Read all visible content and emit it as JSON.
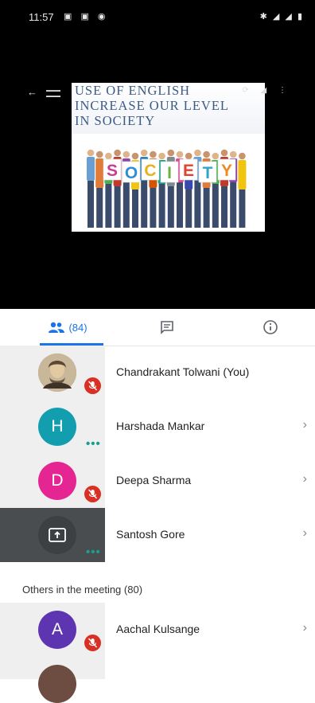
{
  "status_bar": {
    "time": "11:57"
  },
  "presentation": {
    "title_line1": "USE OF ENGLISH",
    "title_line2": "INCREASE OUR LEVEL",
    "title_line3": "IN SOCIETY",
    "sign_letters": [
      "S",
      "O",
      "C",
      "I",
      "E",
      "T",
      "Y"
    ],
    "sign_colors": [
      "#c93c8f",
      "#2f8fd6",
      "#e8b21b",
      "#6db33f",
      "#e3402f",
      "#2fa6c8",
      "#f08a1f"
    ]
  },
  "tabs": {
    "people_count": "(84)"
  },
  "participants": [
    {
      "name": "Chandrakant Tolwani (You)",
      "initial": "",
      "avatar_color": "#a1887f",
      "muted": true
    },
    {
      "name": "Harshada Mankar",
      "initial": "H",
      "avatar_color": "#129eaf",
      "muted": false
    },
    {
      "name": "Deepa Sharma",
      "initial": "D",
      "avatar_color": "#e52592",
      "muted": true
    },
    {
      "name": "Santosh Gore",
      "initial": "",
      "avatar_color": "#3c4043",
      "muted": false,
      "presenting": true
    }
  ],
  "others_section": {
    "label": "Others in the meeting (80)"
  },
  "others": [
    {
      "name": "Aachal Kulsange",
      "initial": "A",
      "avatar_color": "#5e35b1",
      "muted": true
    }
  ],
  "colors": {
    "accent": "#1a73e8",
    "mute_red": "#d93025"
  }
}
